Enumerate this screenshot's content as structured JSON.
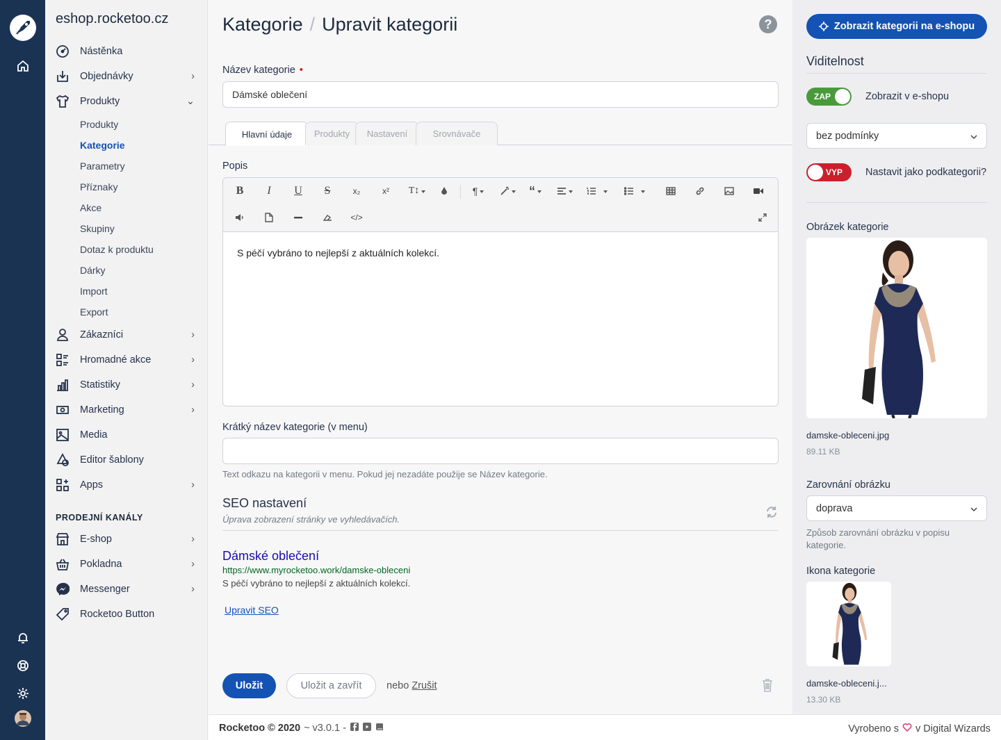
{
  "app": {
    "domain": "eshop.rocketoo.cz"
  },
  "sidebar": {
    "items": [
      {
        "label": "Nástěnka",
        "icon": "dashboard-icon"
      },
      {
        "label": "Objednávky",
        "icon": "download-box-icon"
      },
      {
        "label": "Produkty",
        "icon": "shirt-icon"
      }
    ],
    "subitems": [
      "Produkty",
      "Kategorie",
      "Parametry",
      "Příznaky",
      "Akce",
      "Skupiny",
      "Dotaz k produktu",
      "Dárky",
      "Import",
      "Export"
    ],
    "items2": [
      {
        "label": "Zákazníci",
        "icon": "user-icon"
      },
      {
        "label": "Hromadné akce",
        "icon": "bulk-actions-icon"
      },
      {
        "label": "Statistiky",
        "icon": "chart-icon"
      },
      {
        "label": "Marketing",
        "icon": "money-icon"
      },
      {
        "label": "Media",
        "icon": "image-icon"
      },
      {
        "label": "Editor šablony",
        "icon": "shapes-icon"
      },
      {
        "label": "Apps",
        "icon": "apps-icon"
      }
    ],
    "channels_heading": "PRODEJNÍ KANÁLY",
    "channels": [
      {
        "label": "E-shop",
        "icon": "shop-icon"
      },
      {
        "label": "Pokladna",
        "icon": "basket-icon"
      },
      {
        "label": "Messenger",
        "icon": "messenger-icon"
      },
      {
        "label": "Rocketoo Button",
        "icon": "tag-icon"
      }
    ]
  },
  "header": {
    "breadcrumb_root": "Kategorie",
    "separator": "/",
    "title": "Upravit kategorii",
    "help": "?"
  },
  "form": {
    "name_label": "Název kategorie",
    "required_mark": "•",
    "name_value": "Dámské oblečení",
    "tabs": [
      "Hlavní údaje",
      "Produkty",
      "Nastavení",
      "Srovnávače"
    ],
    "desc_label": "Popis",
    "desc_text": "S péčí vybráno to nejlepší z aktuálních kolekcí.",
    "short_label": "Krátký název kategorie (v menu)",
    "short_value": "",
    "short_hint": "Text odkazu na kategorii v menu. Pokud jej nezadáte použije se Název kategorie."
  },
  "seo": {
    "heading": "SEO nastavení",
    "subheading": "Úprava zobrazení stránky ve vyhledávačích.",
    "preview_title": "Dámské oblečení",
    "preview_url": "https://www.myrocketoo.work/damske-obleceni",
    "preview_desc": "S péčí vybráno to nejlepší z aktuálních kolekcí.",
    "edit_link": "Upravit SEO"
  },
  "actions": {
    "save": "Uložit",
    "save_close": "Uložit a zavřít",
    "or": "nebo",
    "cancel": "Zrušit"
  },
  "footer": {
    "left": "Rocketoo © 2020",
    "version": "~ v3.0.1 -",
    "right_before": "Vyrobeno s",
    "right_after": "v Digital Wizards"
  },
  "right": {
    "show_button": "Zobrazit kategorii na e-shopu",
    "visibility_heading": "Viditelnost",
    "toggle_on": "ZAP",
    "show_in_shop": "Zobrazit v e-shopu",
    "condition_value": "bez podmínky",
    "toggle_off": "VYP",
    "subcategory_label": "Nastavit jako podkategorii?",
    "image_heading": "Obrázek kategorie",
    "image_name": "damske-obleceni.jpg",
    "image_size": "89.11 KB",
    "align_heading": "Zarovnání obrázku",
    "align_value": "doprava",
    "align_hint": "Způsob zarovnání obrázku v popisu kategorie.",
    "icon_heading": "Ikona kategorie",
    "icon_name": "damske-obleceni.j...",
    "icon_size": "13.30 KB"
  },
  "colors": {
    "primary": "#1452b4",
    "rail": "#1b3353",
    "on": "#4a9a3c",
    "off": "#c9212c",
    "required": "#d21919"
  }
}
